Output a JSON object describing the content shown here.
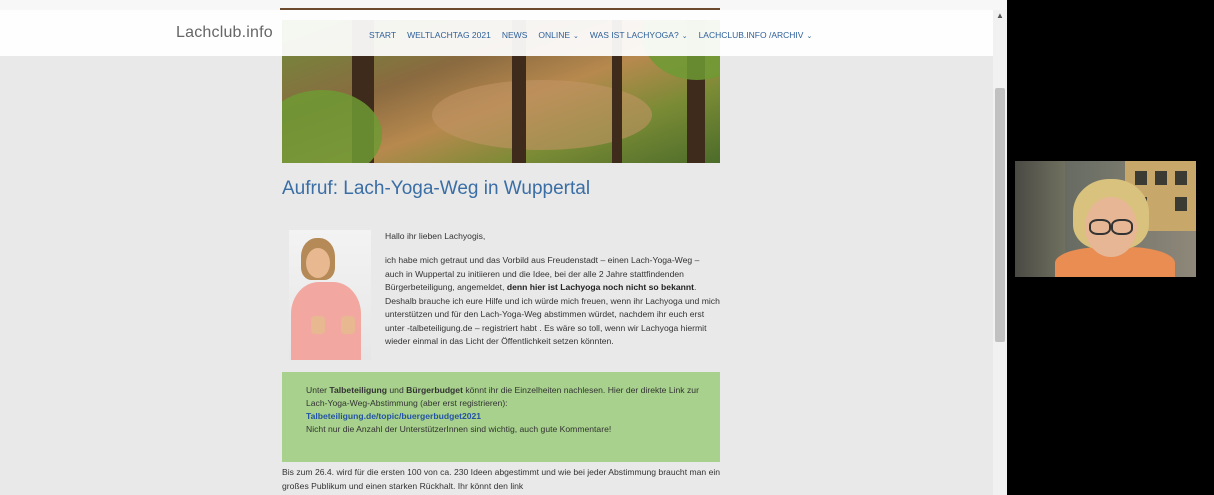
{
  "header": {
    "logo": "Lachclub.info",
    "nav": [
      {
        "label": "START",
        "dropdown": false
      },
      {
        "label": "WELTLACHTAG 2021",
        "dropdown": false
      },
      {
        "label": "NEWS",
        "dropdown": false
      },
      {
        "label": "ONLINE",
        "dropdown": true
      },
      {
        "label": "WAS IST LACHYOGA?",
        "dropdown": true
      },
      {
        "label": "LACHCLUB.INFO /ARCHIV",
        "dropdown": true
      }
    ]
  },
  "article": {
    "title": "Aufruf: Lach-Yoga-Weg in Wuppertal",
    "greeting": "Hallo ihr lieben Lachyogis,",
    "para_1": "ich habe mich getraut und das Vorbild aus Freudenstadt – einen Lach-Yoga-Weg – auch in Wuppertal zu initiieren und die Idee, bei der alle 2 Jahre stattfindenden Bürgerbeteiligung, angemeldet, ",
    "para_bold": "denn hier ist Lachyoga noch nicht so bekannt",
    "para_2": ". Deshalb brauche ich eure Hilfe und ich würde mich freuen, wenn ihr Lachyoga und mich unterstützen und für den Lach-Yoga-Weg abstimmen würdet, nachdem ihr euch erst unter -talbeteiligung.de – registriert habt . Es wäre so toll, wenn wir Lachyoga hiermit wieder einmal in das Licht der Öffentlichkeit setzen könnten.",
    "box": {
      "t1": "Unter ",
      "b1": "Talbeteiligung",
      "t2": " und ",
      "b2": "Bürgerbudget",
      "t3": " könnt ihr die Einzelheiten nachlesen. Hier der direkte Link zur Lach-Yoga-Weg-Abstimmung (aber erst registrieren):",
      "link": "Talbeteiligung.de/topic/buergerbudget2021",
      "t4": "Nicht nur die Anzahl der UnterstützerInnen sind wichtig, auch gute Kommentare!"
    },
    "bottom": "Bis zum 26.4. wird für die ersten 100 von ca. 230 Ideen abgestimmt und wie bei jeder Abstimmung braucht man ein großes Publikum und einen starken Rückhalt. Ihr könnt den link"
  },
  "icons": {
    "chevron": "chevron-down-icon",
    "scroll_up": "scroll-up-arrow-icon"
  },
  "colors": {
    "link": "#2d5f9a",
    "title": "#3a6ea5",
    "box": "#a7d18c"
  }
}
